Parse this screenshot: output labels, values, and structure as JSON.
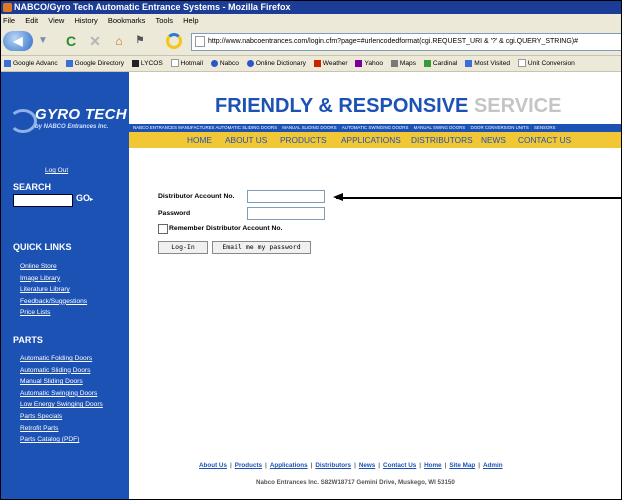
{
  "window": {
    "title": "NABCO/Gyro Tech Automatic Entrance Systems - Mozilla Firefox"
  },
  "menu": [
    "File",
    "Edit",
    "View",
    "History",
    "Bookmarks",
    "Tools",
    "Help"
  ],
  "url": "http://www.nabcoentrances.com/login.cfm?page=#urlencodedformat(cgi.REQUEST_URI & '?' & cgi.QUERY_STRING)#",
  "bookmarks": [
    {
      "label": "Google Advanc",
      "icon": "google-icon",
      "color": "#3a6fd8"
    },
    {
      "label": "Google Directory",
      "icon": "google-icon",
      "color": "#3a6fd8"
    },
    {
      "label": "LYCOS",
      "icon": "lycos-dog-icon",
      "color": "#222222"
    },
    {
      "label": "Hotmail",
      "icon": "page-icon",
      "color": "#ffffff"
    },
    {
      "label": "Nabco",
      "icon": "globe-icon",
      "color": "#2b55c8"
    },
    {
      "label": "Online Dictionary",
      "icon": "dictionary-icon",
      "color": "#2b55c8"
    },
    {
      "label": "Weather",
      "icon": "leaf-icon",
      "color": "#cc2200"
    },
    {
      "label": "Yahoo",
      "icon": "yahoo-icon",
      "color": "#7b0099"
    },
    {
      "label": "Maps",
      "icon": "person-icon",
      "color": "#7a7a7a"
    },
    {
      "label": "Cardinal",
      "icon": "list-icon",
      "color": "#3a9a3a"
    },
    {
      "label": "Most Visited",
      "icon": "star-icon",
      "color": "#3a6fd8"
    },
    {
      "label": "Unit Conversion",
      "icon": "page-icon",
      "color": "#ffffff"
    }
  ],
  "sidebar": {
    "logo_main": "GYRO TECH",
    "logo_sub": "by NABCO Entrances Inc.",
    "login_link": "Log Out",
    "search_label": "SEARCH",
    "go_label": "GO",
    "quick_links_title": "QUICK LINKS",
    "quick_links": [
      "Online Store",
      "Image Library",
      "Literature Library",
      "Feedback/Suggestions",
      "Price Lists"
    ],
    "parts_title": "PARTS",
    "parts_links": [
      "Automatic Folding Doors",
      "Automatic Sliding Doors",
      "Manual Sliding Doors",
      "Automatic Swinging Doors",
      "Low Energy Swinging Doors",
      "Parts Specials",
      "Retrofit Parts",
      "Parts Catalog (PDF)"
    ]
  },
  "header": {
    "tagline_main": "FRIENDLY & RESPONSIVE ",
    "tagline_service": "SERVICE",
    "strip_items": [
      "NABCO ENTRANCES MANUFACTURES AUTOMATIC SLIDING DOORS",
      "MANUAL SLIDING DOORS",
      "AUTOMATIC SWINGING DOORS",
      "MANUAL SWING DOORS",
      "DOOR CONVERSION UNITS",
      "SENSORS"
    ],
    "nav": [
      "HOME",
      "ABOUT US",
      "PRODUCTS",
      "APPLICATIONS",
      "DISTRIBUTORS",
      "NEWS",
      "CONTACT US"
    ]
  },
  "login": {
    "account_label": "Distributor Account No.",
    "account_value": "",
    "password_label": "Password",
    "password_value": "",
    "remember_label": "Remember Distributor Account No.",
    "login_button": "Log-In",
    "email_button": "Email me my password"
  },
  "footer": {
    "links": [
      "About Us",
      "Products",
      "Applications",
      "Distributors",
      "News",
      "Contact Us",
      "Home",
      "Site Map",
      "Admin"
    ],
    "address": "Nabco Entrances Inc. S82W18717 Gemini Drive, Muskego, WI 53150"
  },
  "colors": {
    "brand_blue": "#1d52b5",
    "nav_yellow": "#f2c735",
    "titlebar": "#1b3c97"
  }
}
